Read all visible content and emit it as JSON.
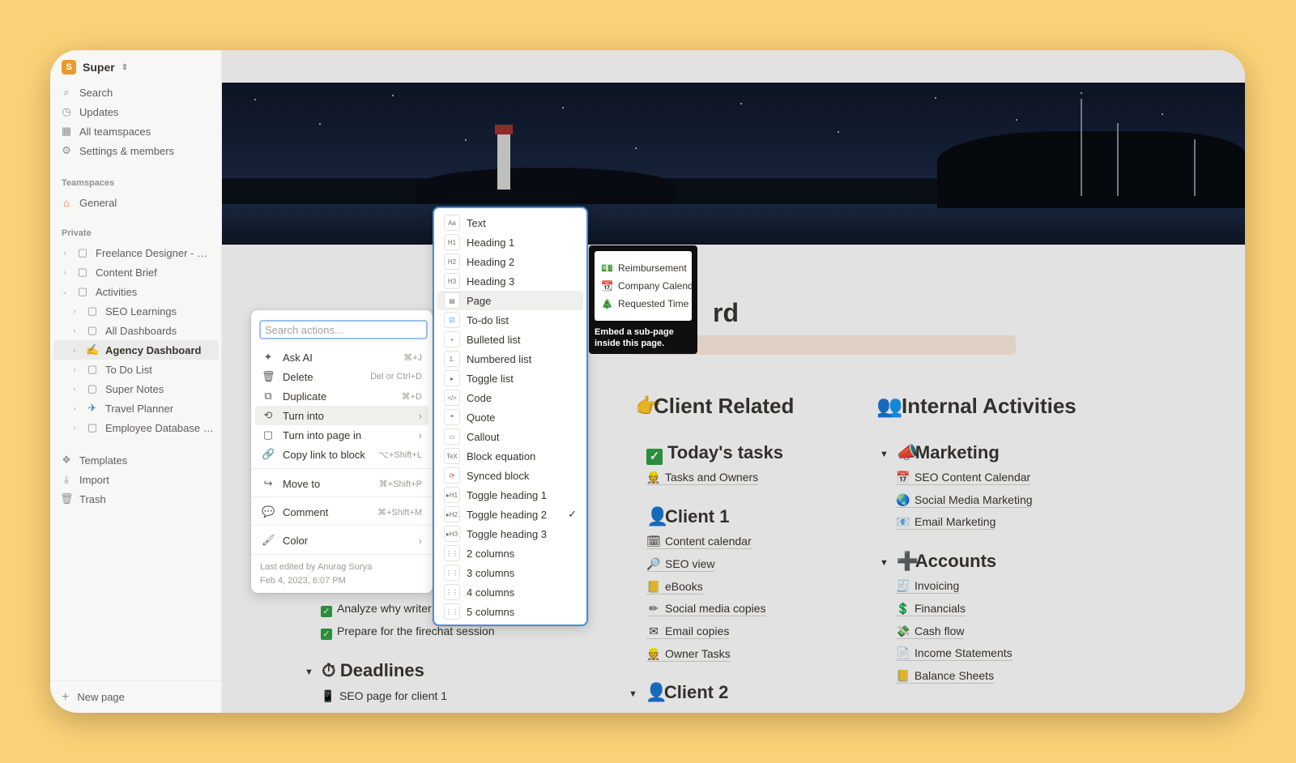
{
  "workspace": {
    "name": "Super",
    "logo": "S"
  },
  "sidebar": {
    "nav": [
      {
        "label": "Search",
        "icon": "search-icon"
      },
      {
        "label": "Updates",
        "icon": "clock-icon"
      },
      {
        "label": "All teamspaces",
        "icon": "grid-icon"
      },
      {
        "label": "Settings & members",
        "icon": "gear-icon"
      }
    ],
    "teamspaces_label": "Teamspaces",
    "teamspaces": [
      {
        "label": "General",
        "icon": "house-icon"
      }
    ],
    "private_label": "Private",
    "pages": [
      {
        "label": "Freelance Designer - Cli...",
        "indent": 0
      },
      {
        "label": "Content Brief",
        "indent": 0
      },
      {
        "label": "Activities",
        "indent": 0,
        "expanded": true
      },
      {
        "label": "SEO Learnings",
        "indent": 1
      },
      {
        "label": "All Dashboards",
        "indent": 1
      },
      {
        "label": "Agency Dashboard",
        "indent": 1,
        "active": true
      },
      {
        "label": "To Do List",
        "indent": 1
      },
      {
        "label": "Super Notes",
        "indent": 1
      },
      {
        "label": "Travel Planner",
        "indent": 1
      },
      {
        "label": "Employee Database - ...",
        "indent": 1
      }
    ],
    "tools": [
      {
        "label": "Templates",
        "icon": "templates-icon"
      },
      {
        "label": "Import",
        "icon": "download-icon"
      },
      {
        "label": "Trash",
        "icon": "trash-icon"
      }
    ],
    "new_page": "New page"
  },
  "page": {
    "title_fragment": "rd",
    "col_client": "Client Related",
    "col_internal": "Internal Activities",
    "todays_tasks": "Today's tasks",
    "tasks_and_owners": "Tasks and Owners",
    "client1": "Client 1",
    "client1_links": [
      "Content calendar",
      "SEO view",
      "eBooks",
      "Social media copies",
      "Email copies",
      "Owner Tasks"
    ],
    "client2": "Client 2",
    "marketing": "Marketing",
    "marketing_links": [
      "SEO Content Calendar",
      "Social Media Marketing",
      "Email Marketing"
    ],
    "accounts": "Accounts",
    "accounts_links": [
      "Invoicing",
      "Financials",
      "Cash flow",
      "Income Statements",
      "Balance Sheets"
    ],
    "todos": [
      "Analyze why writer 1's perfor",
      "Prepare for the firechat session"
    ],
    "deadlines": "Deadlines",
    "deadline_item": "SEO page for client 1"
  },
  "actions_menu": {
    "search_placeholder": "Search actions...",
    "items": [
      {
        "label": "Ask AI",
        "shortcut": "⌘+J",
        "icon": "sparkle-icon"
      },
      {
        "label": "Delete",
        "shortcut": "Del or Ctrl+D",
        "icon": "trash-icon"
      },
      {
        "label": "Duplicate",
        "shortcut": "⌘+D",
        "icon": "duplicate-icon"
      },
      {
        "label": "Turn into",
        "shortcut": "",
        "icon": "turn-into-icon",
        "submenu": true,
        "hover": true
      },
      {
        "label": "Turn into page in",
        "shortcut": "",
        "icon": "page-icon",
        "submenu": true
      },
      {
        "label": "Copy link to block",
        "shortcut": "⌥+Shift+L",
        "icon": "link-icon"
      },
      {
        "label": "Move to",
        "shortcut": "⌘+Shift+P",
        "icon": "move-icon"
      },
      {
        "label": "Comment",
        "shortcut": "⌘+Shift+M",
        "icon": "comment-icon"
      },
      {
        "label": "Color",
        "shortcut": "",
        "icon": "paint-icon",
        "submenu": true
      }
    ],
    "edited_by": "Last edited by Anurag Surya",
    "edited_at": "Feb 4, 2023, 6:07 PM"
  },
  "turn_into": {
    "items": [
      {
        "label": "Text",
        "glyph": "Aa"
      },
      {
        "label": "Heading 1",
        "glyph": "H1"
      },
      {
        "label": "Heading 2",
        "glyph": "H2"
      },
      {
        "label": "Heading 3",
        "glyph": "H3"
      },
      {
        "label": "Page",
        "glyph": "▤",
        "hover": true
      },
      {
        "label": "To-do list",
        "glyph": "☑"
      },
      {
        "label": "Bulleted list",
        "glyph": "•"
      },
      {
        "label": "Numbered list",
        "glyph": "1."
      },
      {
        "label": "Toggle list",
        "glyph": "▸"
      },
      {
        "label": "Code",
        "glyph": "</>"
      },
      {
        "label": "Quote",
        "glyph": "❝"
      },
      {
        "label": "Callout",
        "glyph": "▭"
      },
      {
        "label": "Block equation",
        "glyph": "TeX"
      },
      {
        "label": "Synced block",
        "glyph": "⟳"
      },
      {
        "label": "Toggle heading 1",
        "glyph": "▸H1"
      },
      {
        "label": "Toggle heading 2",
        "glyph": "▸H2",
        "checked": true
      },
      {
        "label": "Toggle heading 3",
        "glyph": "▸H3"
      },
      {
        "label": "2 columns",
        "glyph": "⋮⋮"
      },
      {
        "label": "3 columns",
        "glyph": "⋮⋮"
      },
      {
        "label": "4 columns",
        "glyph": "⋮⋮"
      },
      {
        "label": "5 columns",
        "glyph": "⋮⋮"
      }
    ]
  },
  "tooltip": {
    "preview": [
      "Reimbursement",
      "Company Calend",
      "Requested Time"
    ],
    "text": "Embed a sub-page inside this page."
  }
}
